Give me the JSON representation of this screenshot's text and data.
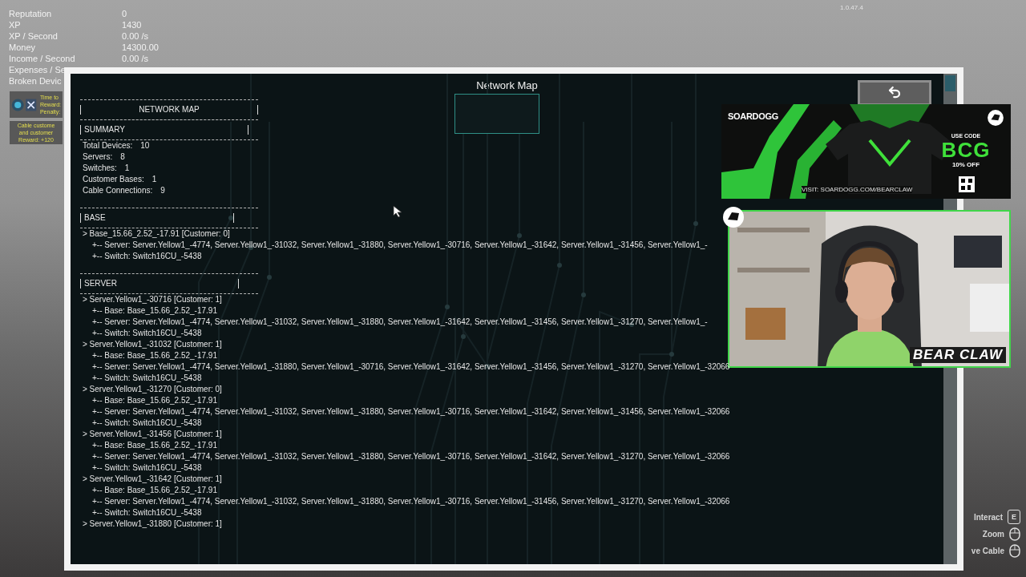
{
  "game_version": "1.0.47.4",
  "stats": [
    {
      "label": "Reputation",
      "value": "0"
    },
    {
      "label": "XP",
      "value": "1430"
    },
    {
      "label": "XP / Second",
      "value": "0.00 /s"
    },
    {
      "label": "Money",
      "value": "14300.00"
    },
    {
      "label": "Income / Second",
      "value": "0.00 /s"
    },
    {
      "label": "Expenses / Se"
    },
    {
      "label": "Broken Devic"
    }
  ],
  "quests": [
    {
      "kind": "timed",
      "lines": [
        "Time to",
        "Reward:",
        "Penalty:"
      ]
    },
    {
      "kind": "plain",
      "lines": [
        "Cable custome",
        "and customer",
        "Reward: +120"
      ]
    }
  ],
  "window": {
    "title": "Network Map"
  },
  "network_map": {
    "title": "NETWORK MAP",
    "sections": [
      {
        "kind": "summary",
        "heading": "SUMMARY",
        "rows": [
          {
            "label": "Total Devices:",
            "value": "10"
          },
          {
            "label": "Servers:",
            "value": "8"
          },
          {
            "label": "Switches:",
            "value": "1"
          },
          {
            "label": "Customer Bases:",
            "value": "1"
          },
          {
            "label": "Cable Connections:",
            "value": "9"
          }
        ]
      },
      {
        "kind": "tree",
        "heading": "BASE",
        "nodes": [
          {
            "text": "> Base_15.66_2.52_-17.91 [Customer: 0]",
            "children": [
              {
                "text": "+-- Server: Server.Yellow1_-4774, Server.Yellow1_-31032, Server.Yellow1_-31880, Server.Yellow1_-30716, Server.Yellow1_-31642, Server.Yellow1_-31456, Server.Yellow1_-"
              },
              {
                "text": "+-- Switch: Switch16CU_-5438"
              }
            ]
          }
        ]
      },
      {
        "kind": "tree",
        "heading": "SERVER",
        "nodes": [
          {
            "text": "> Server.Yellow1_-30716 [Customer: 1]",
            "children": [
              {
                "text": "+-- Base: Base_15.66_2.52_-17.91"
              },
              {
                "text": "+-- Server: Server.Yellow1_-4774, Server.Yellow1_-31032, Server.Yellow1_-31880, Server.Yellow1_-31642, Server.Yellow1_-31456, Server.Yellow1_-31270, Server.Yellow1_-"
              },
              {
                "text": "+-- Switch: Switch16CU_-5438"
              }
            ]
          },
          {
            "text": "> Server.Yellow1_-31032 [Customer: 1]",
            "children": [
              {
                "text": "+-- Base: Base_15.66_2.52_-17.91"
              },
              {
                "text": "+-- Server: Server.Yellow1_-4774, Server.Yellow1_-31880, Server.Yellow1_-30716, Server.Yellow1_-31642, Server.Yellow1_-31456, Server.Yellow1_-31270, Server.Yellow1_-32066"
              },
              {
                "text": "+-- Switch: Switch16CU_-5438"
              }
            ]
          },
          {
            "text": "> Server.Yellow1_-31270 [Customer: 0]",
            "children": [
              {
                "text": "+-- Base: Base_15.66_2.52_-17.91"
              },
              {
                "text": "+-- Server: Server.Yellow1_-4774, Server.Yellow1_-31032, Server.Yellow1_-31880, Server.Yellow1_-30716, Server.Yellow1_-31642, Server.Yellow1_-31456, Server.Yellow1_-32066"
              },
              {
                "text": "+-- Switch: Switch16CU_-5438"
              }
            ]
          },
          {
            "text": "> Server.Yellow1_-31456 [Customer: 1]",
            "children": [
              {
                "text": "+-- Base: Base_15.66_2.52_-17.91"
              },
              {
                "text": "+-- Server: Server.Yellow1_-4774, Server.Yellow1_-31032, Server.Yellow1_-31880, Server.Yellow1_-30716, Server.Yellow1_-31642, Server.Yellow1_-31270, Server.Yellow1_-32066"
              },
              {
                "text": "+-- Switch: Switch16CU_-5438"
              }
            ]
          },
          {
            "text": "> Server.Yellow1_-31642 [Customer: 1]",
            "children": [
              {
                "text": "+-- Base: Base_15.66_2.52_-17.91"
              },
              {
                "text": "+-- Server: Server.Yellow1_-4774, Server.Yellow1_-31032, Server.Yellow1_-31880, Server.Yellow1_-30716, Server.Yellow1_-31456, Server.Yellow1_-31270, Server.Yellow1_-32066"
              },
              {
                "text": "+-- Switch: Switch16CU_-5438"
              }
            ]
          },
          {
            "text": "> Server.Yellow1_-31880 [Customer: 1]"
          }
        ]
      }
    ]
  },
  "ad": {
    "brand": "SOARDOGG",
    "promo": "USE CODE",
    "code": "BCG",
    "discount": "10% OFF",
    "url": "VISIT: SOARDOGG.COM/BEARCLAW"
  },
  "webcam": {
    "kind": "picture",
    "caption": "BEAR CLAW"
  },
  "hints": [
    {
      "kind": "key",
      "label": "Interact",
      "key": "E"
    },
    {
      "kind": "mouse",
      "label": "Zoom"
    },
    {
      "kind": "mouse",
      "label": "ve Cable"
    }
  ]
}
